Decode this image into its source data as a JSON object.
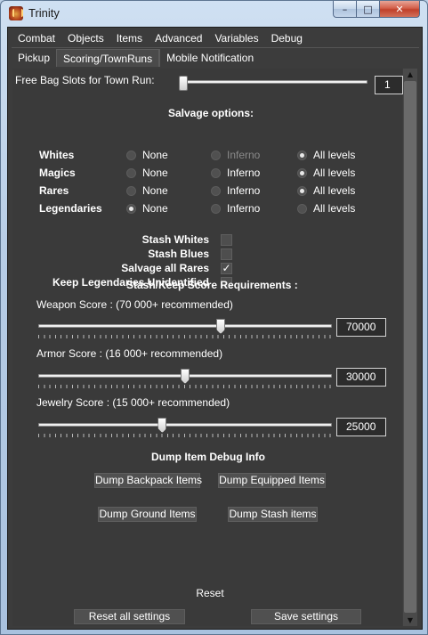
{
  "window": {
    "title": "Trinity",
    "controls": {
      "minimize": "–",
      "maximize": "□",
      "close": "✕"
    }
  },
  "menu": {
    "row1": [
      "Combat",
      "Objects",
      "Items",
      "Advanced",
      "Variables",
      "Debug"
    ],
    "row2": [
      "Pickup",
      "Scoring/TownRuns",
      "Mobile Notification"
    ],
    "active_tab": "Scoring/TownRuns"
  },
  "bag_slots": {
    "label": "Free Bag Slots for Town Run:",
    "value": "1",
    "level": 0.0
  },
  "salvage": {
    "title": "Salvage options:",
    "columns": [
      "None",
      "Inferno",
      "All levels"
    ],
    "rows": [
      {
        "label": "Whites",
        "selected": "All levels",
        "inferno_disabled": true
      },
      {
        "label": "Magics",
        "selected": "All levels",
        "inferno_disabled": false
      },
      {
        "label": "Rares",
        "selected": "All levels",
        "inferno_disabled": false
      },
      {
        "label": "Legendaries",
        "selected": "None",
        "inferno_disabled": false
      }
    ]
  },
  "stash_options": [
    {
      "label": "Stash Whites",
      "checked": false
    },
    {
      "label": "Stash Blues",
      "checked": false
    },
    {
      "label": "Salvage all Rares",
      "checked": true
    },
    {
      "label": "Keep Legendaries Unidentified",
      "checked": false
    }
  ],
  "check_glyph": "✓",
  "score": {
    "title": "Stash/Keep Score Requirements :",
    "weapon": {
      "label": "Weapon Score : (70 000+ recommended)",
      "value": "70000",
      "level": 0.625
    },
    "armor": {
      "label": "Armor Score : (16 000+ recommended)",
      "value": "30000",
      "level": 0.5
    },
    "jewelry": {
      "label": "Jewelry Score : (15 000+ recommended)",
      "value": "25000",
      "level": 0.42
    }
  },
  "debug": {
    "title": "Dump Item Debug Info",
    "dump_backpack": "Dump Backpack Items",
    "dump_equipped": "Dump Equipped Items",
    "dump_ground": "Dump Ground Items",
    "dump_stash": "Dump Stash items"
  },
  "footer": {
    "reset": "Reset",
    "reset_all": "Reset all settings",
    "save": "Save settings"
  },
  "scrollbar": {
    "up": "▲",
    "down": "▼"
  }
}
